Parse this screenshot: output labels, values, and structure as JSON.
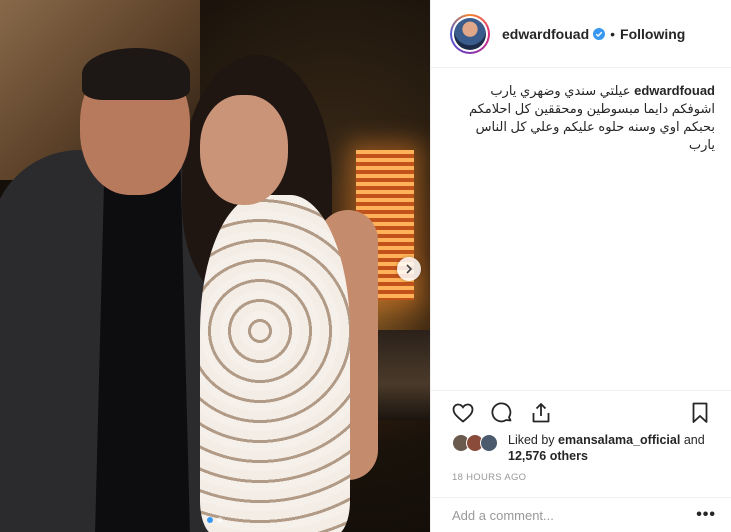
{
  "post": {
    "username": "edwardfouad",
    "follow_state": "Following",
    "separator": "•",
    "caption": {
      "user": "edwardfouad",
      "text": "عيلتي سندي وضهري يارب اشوفكم دايما مبسوطين ومحققين كل احلامكم بحبكم اوي وسنه حلوه عليكم وعلي كل الناس يارب"
    },
    "photo": {
      "carousel_total": 2,
      "carousel_active": 1
    },
    "likes": {
      "prefix": "Liked by",
      "liker": "emansalama_official",
      "joiner": "and",
      "others": "12,576 others"
    },
    "timestamp": "18 HOURS AGO",
    "comment": {
      "placeholder": "Add a comment...",
      "more": "•••"
    }
  },
  "colors": {
    "verified": "#3897f0",
    "text": "#262626",
    "muted": "#999999",
    "border": "#efefef"
  },
  "icons": {
    "verified": "verified-badge-icon",
    "like": "heart-icon",
    "comment": "comment-bubble-icon",
    "share": "share-icon",
    "save": "bookmark-icon",
    "next": "chevron-right-icon",
    "more": "more-options-icon"
  }
}
